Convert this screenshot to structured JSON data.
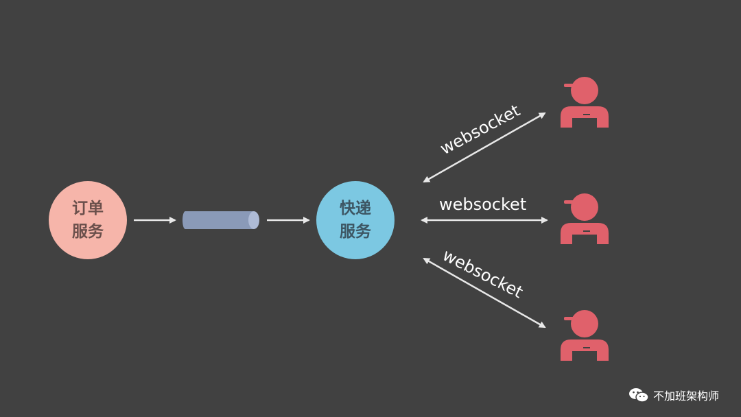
{
  "nodes": {
    "order_service": "订单\n服务",
    "express_service": "快递\n服务"
  },
  "connections": {
    "top_label": "websocket",
    "middle_label": "websocket",
    "bottom_label": "websocket"
  },
  "couriers": {
    "count": 3
  },
  "colors": {
    "background": "#414141",
    "order_service": "#f6b5aa",
    "express_service": "#7cc8e2",
    "queue": "#8a9ab8",
    "courier": "#e0616b",
    "arrow": "#e8e8e8"
  },
  "watermark": {
    "text": "不加班架构师",
    "icon": "wechat-icon"
  }
}
